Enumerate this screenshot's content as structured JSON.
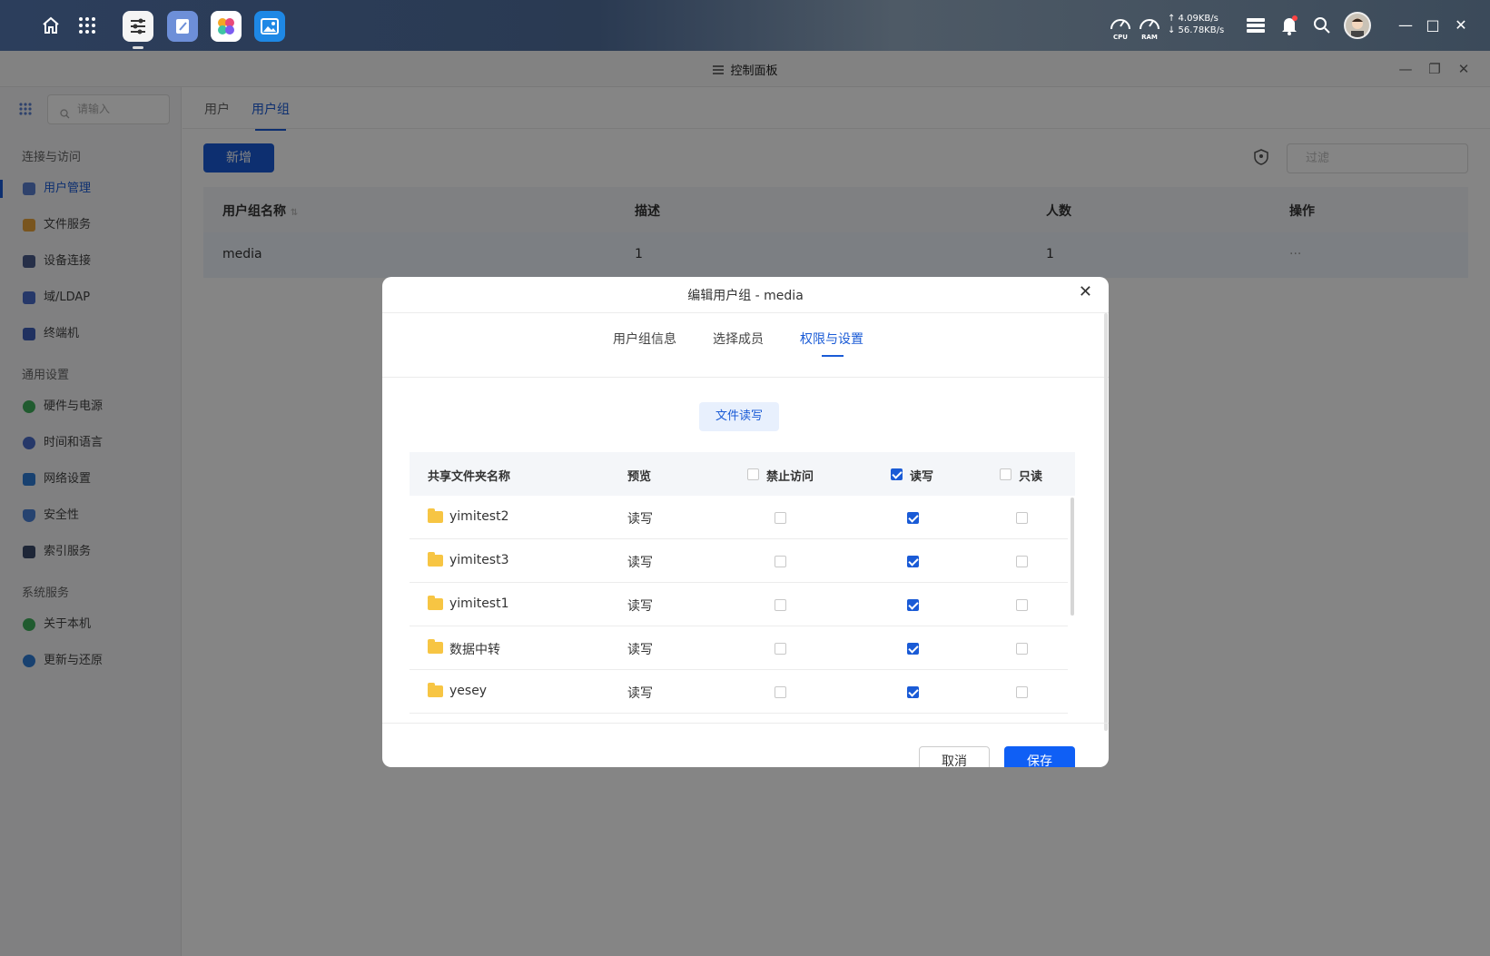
{
  "taskbar": {
    "apps": [
      {
        "name": "control-panel-app-icon",
        "active": true
      },
      {
        "name": "notes-app-icon"
      },
      {
        "name": "app-store-icon"
      },
      {
        "name": "photos-app-icon"
      }
    ],
    "gauges": [
      {
        "label": "CPU"
      },
      {
        "label": "RAM"
      }
    ],
    "upload": "↑ 4.09KB/s",
    "download": "↓ 56.78KB/s"
  },
  "window": {
    "title": "控制面板"
  },
  "sidebar": {
    "search_placeholder": "请输入",
    "sections": [
      {
        "label": "连接与访问"
      },
      {
        "label": "通用设置"
      },
      {
        "label": "系统服务"
      }
    ],
    "items": [
      {
        "label": "用户管理",
        "color": "#5b7fcf"
      },
      {
        "label": "文件服务",
        "color": "#e8a33b"
      },
      {
        "label": "设备连接",
        "color": "#4a5a8a"
      },
      {
        "label": "域/LDAP",
        "color": "#4a6cc9"
      },
      {
        "label": "终端机",
        "color": "#3f5fb8"
      },
      {
        "label": "硬件与电源",
        "color": "#3fae5a"
      },
      {
        "label": "时间和语言",
        "color": "#4a6cc9"
      },
      {
        "label": "网络设置",
        "color": "#2e7dd6"
      },
      {
        "label": "安全性",
        "color": "#4a80d6"
      },
      {
        "label": "索引服务",
        "color": "#3a4a6a"
      },
      {
        "label": "关于本机",
        "color": "#3fae5a"
      },
      {
        "label": "更新与还原",
        "color": "#2e7dd6"
      }
    ]
  },
  "main": {
    "tabs": [
      "用户",
      "用户组"
    ],
    "add_button": "新增",
    "filter_placeholder": "过滤",
    "columns": [
      "用户组名称",
      "描述",
      "人数",
      "操作"
    ],
    "rows": [
      {
        "name": "media",
        "desc": "1",
        "count": "1",
        "action": "···"
      }
    ]
  },
  "dialog": {
    "title": "编辑用户组 - media",
    "tabs": [
      "用户组信息",
      "选择成员",
      "权限与设置"
    ],
    "chip": "文件读写",
    "columns": {
      "folder": "共享文件夹名称",
      "preview": "预览",
      "deny": "禁止访问",
      "rw": "读写",
      "ro": "只读"
    },
    "header_checks": {
      "deny": false,
      "rw": true,
      "ro": false
    },
    "rows": [
      {
        "folder": "yimitest2",
        "preview": "读写",
        "deny": false,
        "rw": true,
        "ro": false
      },
      {
        "folder": "yimitest3",
        "preview": "读写",
        "deny": false,
        "rw": true,
        "ro": false
      },
      {
        "folder": "yimitest1",
        "preview": "读写",
        "deny": false,
        "rw": true,
        "ro": false
      },
      {
        "folder": "数据中转",
        "preview": "读写",
        "deny": false,
        "rw": true,
        "ro": false
      },
      {
        "folder": "yesey",
        "preview": "读写",
        "deny": false,
        "rw": true,
        "ro": false
      }
    ],
    "cancel": "取消",
    "save": "保存"
  }
}
